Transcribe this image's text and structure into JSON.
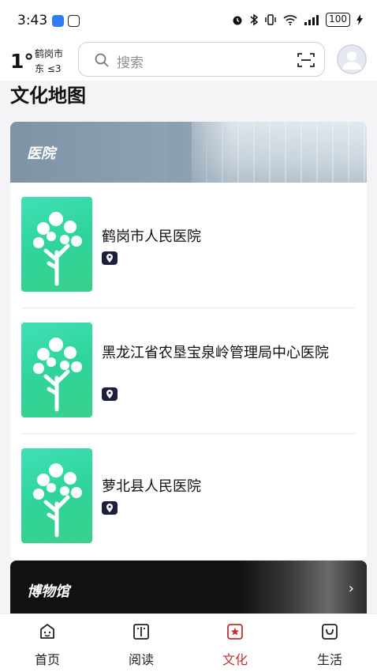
{
  "status_bar": {
    "time": "3:43",
    "battery": "100"
  },
  "header": {
    "weather": {
      "temperature": "1°",
      "city": "鹤岗市",
      "wind": "东 ≤3"
    },
    "search": {
      "placeholder": "搜索"
    }
  },
  "page": {
    "title": "文化地图"
  },
  "hospital_section": {
    "title": "医院",
    "items": [
      {
        "name": "鹤岗市人民医院"
      },
      {
        "name": "黑龙江省农垦宝泉岭管理局中心医院"
      },
      {
        "name": "萝北县人民医院"
      }
    ]
  },
  "museum_section": {
    "title": "博物馆"
  },
  "bottom_nav": {
    "tabs": [
      {
        "label": "首页",
        "icon": "home-icon",
        "active": false
      },
      {
        "label": "阅读",
        "icon": "book-icon",
        "active": false
      },
      {
        "label": "文化",
        "icon": "culture-star-icon",
        "active": true
      },
      {
        "label": "生活",
        "icon": "life-bag-icon",
        "active": false
      }
    ]
  },
  "colors": {
    "accent": "#c4302b",
    "thumb_green": "#2fd49a",
    "location_badge": "#1c1f3a"
  }
}
